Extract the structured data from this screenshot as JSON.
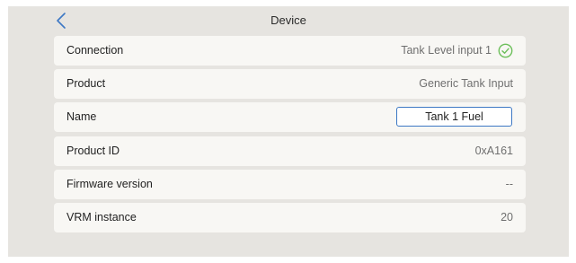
{
  "header": {
    "title": "Device",
    "back_icon": "chevron-left-icon"
  },
  "colors": {
    "accent": "#3d78c4",
    "success": "#6cbf5a",
    "row_background": "#f8f7f4",
    "page_background": "#e6e4e0"
  },
  "rows": {
    "connection": {
      "label": "Connection",
      "value": "Tank Level input 1",
      "icon": "check-circle-icon"
    },
    "product": {
      "label": "Product",
      "value": "Generic Tank Input"
    },
    "name": {
      "label": "Name",
      "value": "Tank 1 Fuel"
    },
    "product_id": {
      "label": "Product ID",
      "value": "0xA161"
    },
    "firmware_version": {
      "label": "Firmware version",
      "value": "--"
    },
    "vrm_instance": {
      "label": "VRM instance",
      "value": "20"
    }
  }
}
